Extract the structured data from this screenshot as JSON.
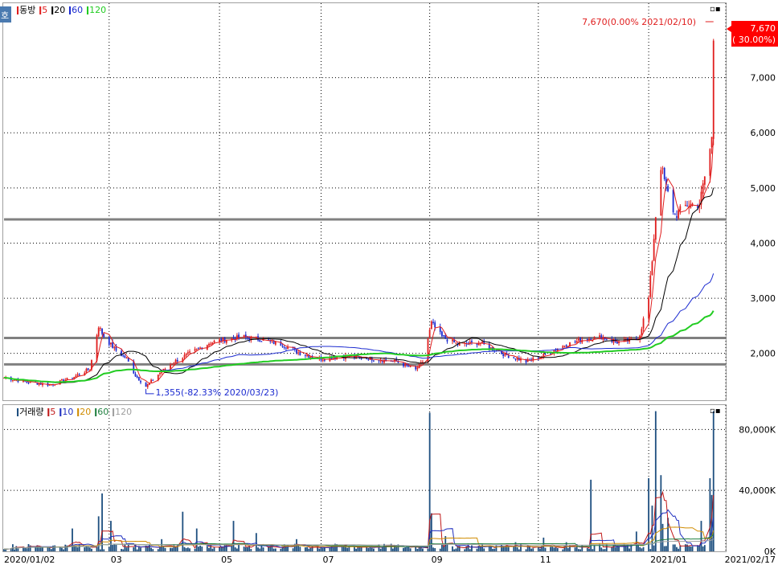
{
  "colors": {
    "up": "#e01e1e",
    "down": "#1c2bd0",
    "ma5": "#e01e1e",
    "ma20": "#000000",
    "ma60": "#1c2bd0",
    "ma120": "#22cc22",
    "vol": "#1f5080",
    "vma5": "#c01818",
    "vma10": "#2030c0",
    "vma20": "#d08c00",
    "vma60": "#208040",
    "vma120": "#a0a0a0",
    "hline": "#808080",
    "frame": "#a0a0a0",
    "grid": "#000000",
    "badge": "#ff0000"
  },
  "price_panel": {
    "legend": [
      {
        "label": "동방",
        "color": "#e01e1e",
        "mark": "ǀ"
      },
      {
        "label": "5",
        "color": "#e01e1e",
        "mark": "ǀ"
      },
      {
        "label": "20",
        "color": "#000000",
        "mark": "ǀ"
      },
      {
        "label": "60",
        "color": "#1c2bd0",
        "mark": "ǀ"
      },
      {
        "label": "120",
        "color": "#22cc22",
        "mark": "ǀ"
      }
    ],
    "max_annotation": "7,670(0.00% 2021/02/10)",
    "min_annotation": "1,355(-82.33% 2020/03/23)",
    "price_badge": {
      "value": "7,670",
      "change": "( 30.00%)"
    },
    "side_label": "호",
    "window_icons": "▫▪"
  },
  "volume_panel": {
    "legend": [
      {
        "label": "거래량",
        "color": "#1f5080",
        "mark": "ǀ"
      },
      {
        "label": "5",
        "color": "#c01818",
        "mark": "ǀ"
      },
      {
        "label": "10",
        "color": "#2030c0",
        "mark": "ǀ"
      },
      {
        "label": "20",
        "color": "#d08c00",
        "mark": "ǀ"
      },
      {
        "label": "60",
        "color": "#208040",
        "mark": "ǀ"
      },
      {
        "label": "120",
        "color": "#a0a0a0",
        "mark": "ǀ"
      }
    ],
    "window_icons": "▫▪"
  },
  "chart_data": [
    {
      "type": "candlestick",
      "title": "",
      "x_range": [
        "2020/01/02",
        "2021/02/17"
      ],
      "x_tick_labels": [
        {
          "label": "2020/01/02",
          "date": "2020-01-02"
        },
        {
          "label": "03",
          "date": "2020-03-02"
        },
        {
          "label": "05",
          "date": "2020-05-04"
        },
        {
          "label": "07",
          "date": "2020-07-01"
        },
        {
          "label": "09",
          "date": "2020-09-01"
        },
        {
          "label": "11",
          "date": "2020-11-02"
        },
        {
          "label": "2021/01",
          "date": "2021-01-04"
        },
        {
          "label": "2021/02/17",
          "date": "2021-02-17"
        }
      ],
      "ylim": [
        1150,
        8350
      ],
      "y_ticks": [
        2000,
        3000,
        4000,
        5000,
        6000,
        7000
      ],
      "y_tick_labels": [
        "2,000",
        "3,000",
        "4,000",
        "5,000",
        "6,000",
        "7,000"
      ],
      "horizontal_lines": [
        4430,
        2280,
        1800
      ],
      "close_anchors": [
        [
          "2020-01-02",
          1560
        ],
        [
          "2020-01-15",
          1480
        ],
        [
          "2020-01-28",
          1430
        ],
        [
          "2020-02-10",
          1560
        ],
        [
          "2020-02-20",
          1720
        ],
        [
          "2020-02-25",
          2500
        ],
        [
          "2020-02-28",
          2300
        ],
        [
          "2020-03-06",
          2050
        ],
        [
          "2020-03-12",
          1900
        ],
        [
          "2020-03-17",
          1600
        ],
        [
          "2020-03-23",
          1400
        ],
        [
          "2020-03-30",
          1620
        ],
        [
          "2020-04-08",
          1850
        ],
        [
          "2020-04-20",
          2050
        ],
        [
          "2020-04-29",
          2200
        ],
        [
          "2020-05-07",
          2250
        ],
        [
          "2020-05-18",
          2300
        ],
        [
          "2020-05-28",
          2250
        ],
        [
          "2020-06-10",
          2150
        ],
        [
          "2020-06-19",
          2000
        ],
        [
          "2020-07-01",
          1900
        ],
        [
          "2020-07-15",
          1950
        ],
        [
          "2020-07-31",
          1900
        ],
        [
          "2020-08-13",
          1850
        ],
        [
          "2020-08-24",
          1700
        ],
        [
          "2020-08-28",
          1850
        ],
        [
          "2020-09-02",
          2550
        ],
        [
          "2020-09-08",
          2300
        ],
        [
          "2020-09-18",
          2150
        ],
        [
          "2020-09-29",
          2200
        ],
        [
          "2020-10-12",
          2000
        ],
        [
          "2020-10-26",
          1850
        ],
        [
          "2020-11-04",
          1950
        ],
        [
          "2020-11-17",
          2150
        ],
        [
          "2020-11-27",
          2250
        ],
        [
          "2020-12-08",
          2300
        ],
        [
          "2020-12-17",
          2200
        ],
        [
          "2020-12-28",
          2250
        ],
        [
          "2020-12-30",
          2350
        ],
        [
          "2021-01-04",
          3000
        ],
        [
          "2021-01-06",
          3700
        ],
        [
          "2021-01-08",
          4500
        ],
        [
          "2021-01-11",
          5400
        ],
        [
          "2021-01-14",
          5000
        ],
        [
          "2021-01-19",
          4500
        ],
        [
          "2021-01-26",
          4700
        ],
        [
          "2021-02-02",
          4700
        ],
        [
          "2021-02-05",
          5200
        ],
        [
          "2021-02-08",
          5700
        ],
        [
          "2021-02-09",
          5900
        ],
        [
          "2021-02-10",
          7670
        ]
      ],
      "annotated_high": {
        "date": "2021-02-10",
        "value": 7670
      },
      "annotated_low": {
        "date": "2020-03-23",
        "value": 1355
      },
      "ma_periods": [
        5,
        20,
        60,
        120
      ]
    },
    {
      "type": "bar",
      "title": "",
      "ylim": [
        0,
        96000
      ],
      "y_ticks": [
        0,
        40000,
        80000
      ],
      "y_tick_labels": [
        "0K",
        "40,000K",
        "80,000K"
      ],
      "base_volume": 2500,
      "volume_spikes": [
        [
          "2020-02-10",
          15000
        ],
        [
          "2020-02-25",
          23000
        ],
        [
          "2020-02-27",
          38000
        ],
        [
          "2020-03-03",
          20000
        ],
        [
          "2020-04-01",
          8000
        ],
        [
          "2020-04-13",
          26000
        ],
        [
          "2020-04-21",
          15000
        ],
        [
          "2020-05-12",
          20000
        ],
        [
          "2020-05-25",
          12000
        ],
        [
          "2020-06-17",
          8000
        ],
        [
          "2020-09-01",
          91000
        ],
        [
          "2020-09-02",
          25000
        ],
        [
          "2020-09-10",
          10000
        ],
        [
          "2020-10-20",
          6000
        ],
        [
          "2020-11-05",
          9000
        ],
        [
          "2020-11-18",
          6000
        ],
        [
          "2020-12-02",
          47000
        ],
        [
          "2020-12-28",
          13000
        ],
        [
          "2021-01-04",
          48000
        ],
        [
          "2021-01-06",
          30000
        ],
        [
          "2021-01-08",
          92000
        ],
        [
          "2021-01-11",
          50000
        ],
        [
          "2021-01-12",
          18000
        ],
        [
          "2021-01-15",
          22000
        ],
        [
          "2021-02-03",
          20000
        ],
        [
          "2021-02-08",
          48000
        ],
        [
          "2021-02-09",
          37000
        ],
        [
          "2021-02-10",
          92000
        ]
      ],
      "ma_periods": [
        5,
        10,
        20,
        60,
        120
      ]
    }
  ]
}
